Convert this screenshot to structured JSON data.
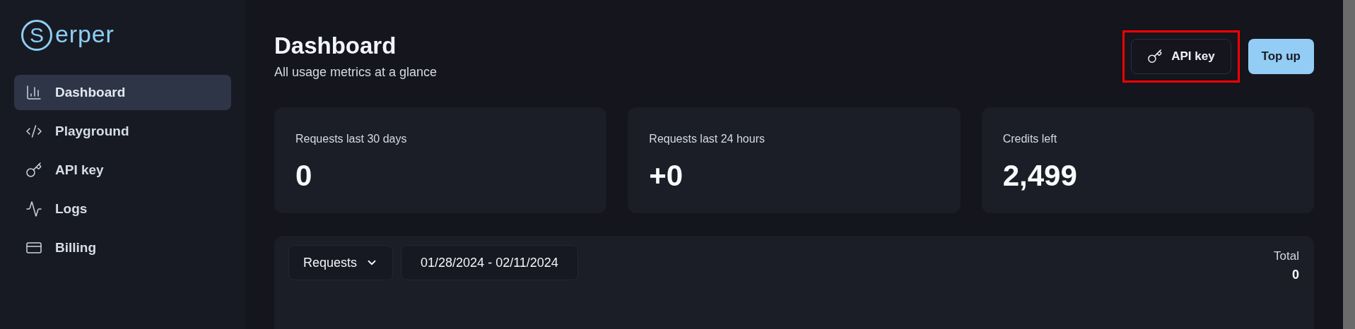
{
  "logo": {
    "mark": "S",
    "text": "erper"
  },
  "sidebar": {
    "items": [
      {
        "label": "Dashboard",
        "kind": "chart",
        "selected": true
      },
      {
        "label": "Playground",
        "kind": "code",
        "selected": false
      },
      {
        "label": "API key",
        "kind": "key",
        "selected": false
      },
      {
        "label": "Logs",
        "kind": "pulse",
        "selected": false
      },
      {
        "label": "Billing",
        "kind": "card",
        "selected": false
      }
    ]
  },
  "header": {
    "title": "Dashboard",
    "subtitle": "All usage metrics at a glance"
  },
  "actions": [
    {
      "label": "API key",
      "kind": "outline",
      "highlighted": true
    },
    {
      "label": "Top up",
      "kind": "primary",
      "highlighted": false
    }
  ],
  "stats": [
    {
      "label": "Requests last 30 days",
      "value": "0"
    },
    {
      "label": "Requests last 24 hours",
      "value": "+0"
    },
    {
      "label": "Credits left",
      "value": "2,499"
    }
  ],
  "chart_panel": {
    "metric": "Requests",
    "date_range": "01/28/2024 - 02/11/2024",
    "total_label": "Total",
    "total_value": "0"
  }
}
